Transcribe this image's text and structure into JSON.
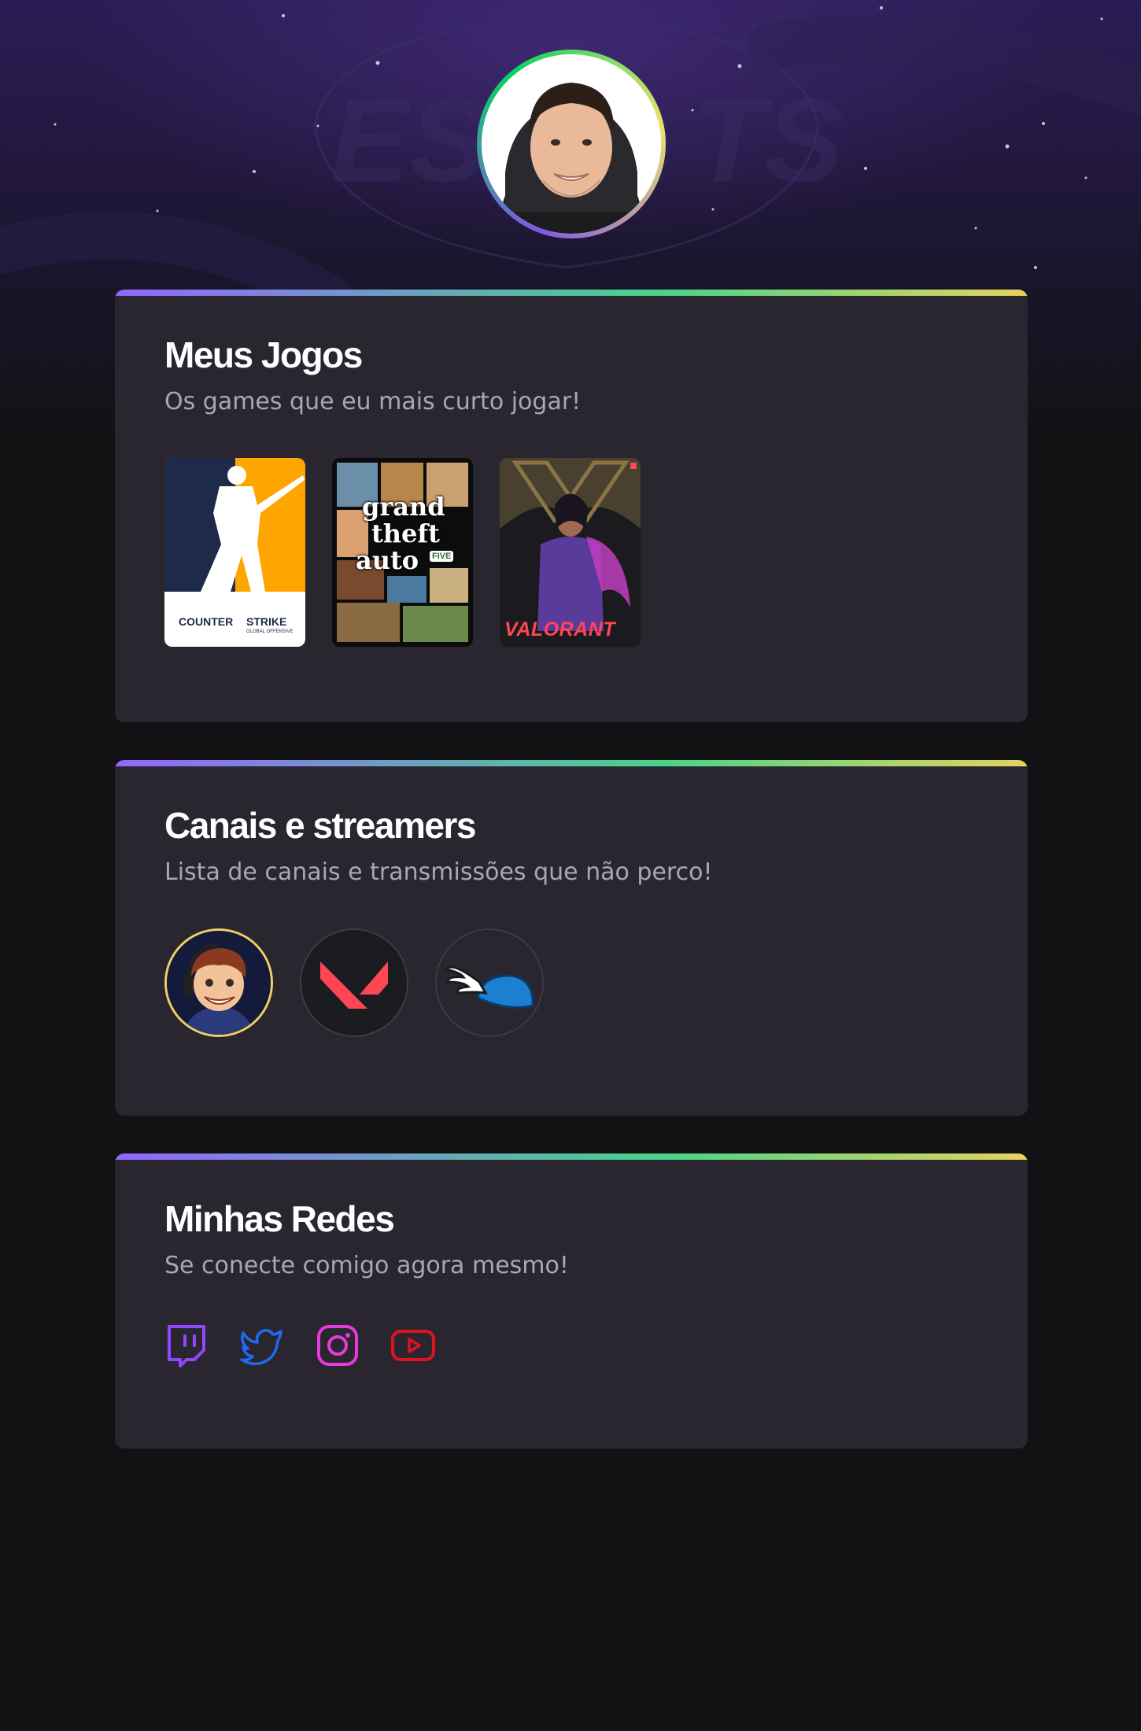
{
  "profile": {
    "avatar_alt": "Foto de perfil"
  },
  "games_section": {
    "title": "Meus Jogos",
    "subtitle": "Os games que eu mais curto jogar!",
    "games": [
      {
        "name": "Counter-Strike",
        "cover_text": "COUNTER",
        "cover_text2": "STRIKE",
        "cover_small": "GLOBAL OFFENSIVE",
        "bg": "#ffa500"
      },
      {
        "name": "Grand Theft Auto V",
        "cover_text": "grand",
        "cover_text2": "theft",
        "cover_text3": "auto",
        "cover_small": "FIVE"
      },
      {
        "name": "Valorant",
        "cover_text": "VALORANT"
      }
    ]
  },
  "channels_section": {
    "title": "Canais e streamers",
    "subtitle": "Lista de canais e transmissões que não perco!",
    "channels": [
      {
        "name": "streamer-avatar"
      },
      {
        "name": "valorant-channel"
      },
      {
        "name": "winged-helmet-channel"
      }
    ]
  },
  "socials_section": {
    "title": "Minhas Redes",
    "subtitle": "Se conecte comigo agora mesmo!",
    "links": [
      {
        "icon": "twitch-icon",
        "color": "#9146ff"
      },
      {
        "icon": "twitter-icon",
        "color": "#1d6bf0"
      },
      {
        "icon": "instagram-icon",
        "color": "#e33bde"
      },
      {
        "icon": "youtube-icon",
        "color": "#e0121e"
      }
    ]
  },
  "colors": {
    "background": "#121214",
    "card": "#29262f",
    "accent_purple": "#8257e5",
    "accent_green": "#04d361",
    "accent_yellow": "#f0e16c"
  }
}
